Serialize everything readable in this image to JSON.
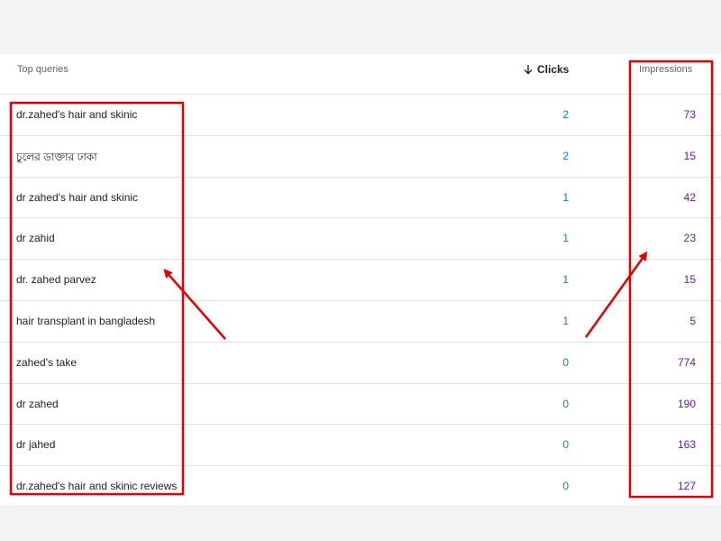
{
  "table": {
    "header": {
      "queries_label": "Top queries",
      "clicks_label": "Clicks",
      "impressions_label": "Impressions",
      "sort_icon": "arrow-down-icon"
    },
    "rows": [
      {
        "query": "dr.zahed's hair and skinic",
        "clicks": "2",
        "impressions": "73"
      },
      {
        "query": "চুলের ডাক্তার ঢাকা",
        "clicks": "2",
        "impressions": "15"
      },
      {
        "query": "dr zahed's hair and skinic",
        "clicks": "1",
        "impressions": "42"
      },
      {
        "query": "dr zahid",
        "clicks": "1",
        "impressions": "23"
      },
      {
        "query": "dr. zahed parvez",
        "clicks": "1",
        "impressions": "15"
      },
      {
        "query": "hair transplant in bangladesh",
        "clicks": "1",
        "impressions": "5"
      },
      {
        "query": "zahed's take",
        "clicks": "0",
        "impressions": "774"
      },
      {
        "query": "dr zahed",
        "clicks": "0",
        "impressions": "190"
      },
      {
        "query": "dr jahed",
        "clicks": "0",
        "impressions": "163"
      },
      {
        "query": "dr.zahed's hair and skinic reviews",
        "clicks": "0",
        "impressions": "127"
      }
    ]
  },
  "colors": {
    "clicks": "#1a73e8",
    "impressions": "#6a1b9a",
    "annotation": "#e00000"
  }
}
